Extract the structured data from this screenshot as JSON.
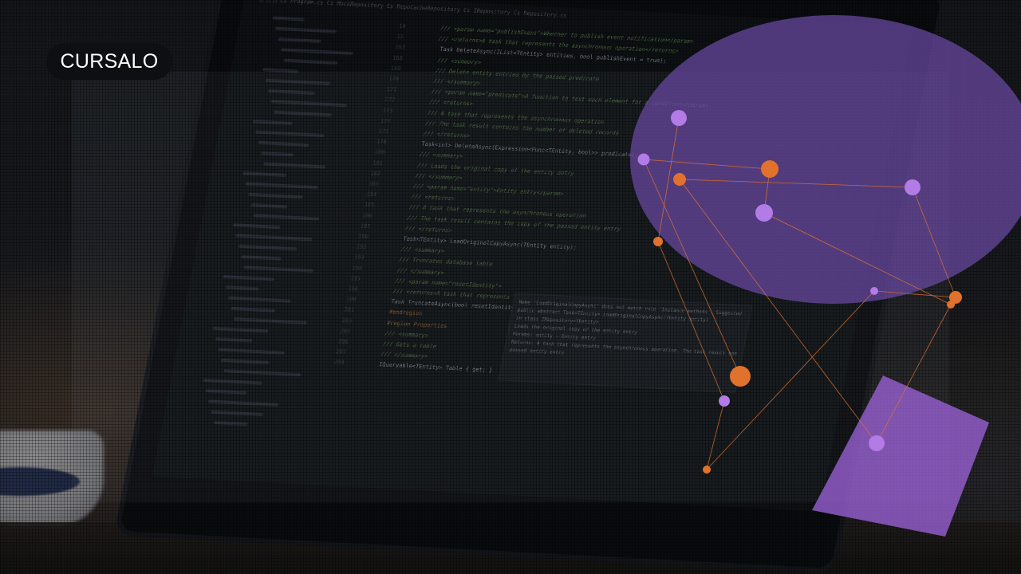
{
  "brand": {
    "name": "CURSALO"
  },
  "colors": {
    "purple": "#b27be6",
    "orange": "#e0722d",
    "ellipse": "#6b4aa3",
    "background": "#141518"
  },
  "code": {
    "toolbar": "□ □ □   Cs Program.cs   Cs MockRepository   Cs RepoCacheRepository   Cs IRepository   Cs Repository.cs",
    "lines": [
      {
        "n": "14",
        "t": "/// <param name=\"publishEvent\">Whether to publish event notification</param>",
        "c": "comment"
      },
      {
        "n": "15",
        "t": "/// <returns>A task that represents the asynchronous operation</returns>",
        "c": "comment"
      },
      {
        "n": "163",
        "t": "Task DeleteAsync(IList<TEntity> entities, bool publishEvent = true);",
        "c": "txt"
      },
      {
        "n": "168",
        "t": "/// <summary>",
        "c": "comment"
      },
      {
        "n": "169",
        "t": "/// Delete entity entries by the passed predicate",
        "c": "comment"
      },
      {
        "n": "170",
        "t": "/// </summary>",
        "c": "comment"
      },
      {
        "n": "171",
        "t": "/// <param name=\"predicate\">A function to test each element for a condition</param>",
        "c": "comment"
      },
      {
        "n": "172",
        "t": "/// <returns>",
        "c": "comment"
      },
      {
        "n": "173",
        "t": "/// A task that represents the asynchronous operation",
        "c": "comment"
      },
      {
        "n": "174",
        "t": "/// The task result contains the number of deleted records",
        "c": "comment"
      },
      {
        "n": "175",
        "t": "/// </returns>",
        "c": "comment"
      },
      {
        "n": "178",
        "t": "Task<int> DeleteAsync(Expression<Func<TEntity, bool>> predicate);",
        "c": "txt"
      },
      {
        "n": "180",
        "t": "/// <summary>",
        "c": "comment"
      },
      {
        "n": "181",
        "t": "/// Loads the original copy of the entity entry",
        "c": "comment"
      },
      {
        "n": "182",
        "t": "/// </summary>",
        "c": "comment"
      },
      {
        "n": "183",
        "t": "/// <param name=\"entity\">Entity entry</param>",
        "c": "comment"
      },
      {
        "n": "184",
        "t": "/// <returns>",
        "c": "comment"
      },
      {
        "n": "185",
        "t": "/// A task that represents the asynchronous operation",
        "c": "comment"
      },
      {
        "n": "186",
        "t": "/// The task result contains the copy of the passed entity entry",
        "c": "comment"
      },
      {
        "n": "187",
        "t": "/// </returns>",
        "c": "comment"
      },
      {
        "n": "190",
        "t": "Task<TEntity> LoadOriginalCopyAsync(TEntity entity);",
        "c": "txt"
      },
      {
        "n": "192",
        "t": "/// <summary>",
        "c": "comment"
      },
      {
        "n": "193",
        "t": "/// Truncates database table",
        "c": "comment"
      },
      {
        "n": "194",
        "t": "/// </summary>",
        "c": "comment"
      },
      {
        "n": "195",
        "t": "/// <param name=\"resetIdentity\">",
        "c": "comment"
      },
      {
        "n": "196",
        "t": "/// <returns>A task that represents",
        "c": "comment"
      },
      {
        "n": "199",
        "t": "Task TruncateAsync(bool resetIdentity",
        "c": "txt"
      },
      {
        "n": "201",
        "t": "#endregion",
        "c": "kw"
      },
      {
        "n": "203",
        "t": "#region Properties",
        "c": "kw"
      },
      {
        "n": "205",
        "t": "/// <summary>",
        "c": "comment"
      },
      {
        "n": "206",
        "t": "/// Gets a table",
        "c": "comment"
      },
      {
        "n": "207",
        "t": "/// </summary>",
        "c": "comment"
      },
      {
        "n": "209",
        "t": "IQueryable<TEntity> Table { get; }",
        "c": "txt"
      }
    ],
    "popup": [
      "Name 'LoadOriginalCopyAsync' does not match rule 'Instance methods'. Suggested name is 'loadOriginalCopyAsync'",
      "public abstract Task<TEntity> LoadOriginalCopyAsync(TEntity entity)",
      "in class IRepository<TEntity>",
      "Loads the original copy of the entity entry",
      "Params: entity – Entity entry",
      "Returns: A task that represents the asynchronous operation. The task result contains the copy of the",
      "passed entity entry"
    ]
  }
}
